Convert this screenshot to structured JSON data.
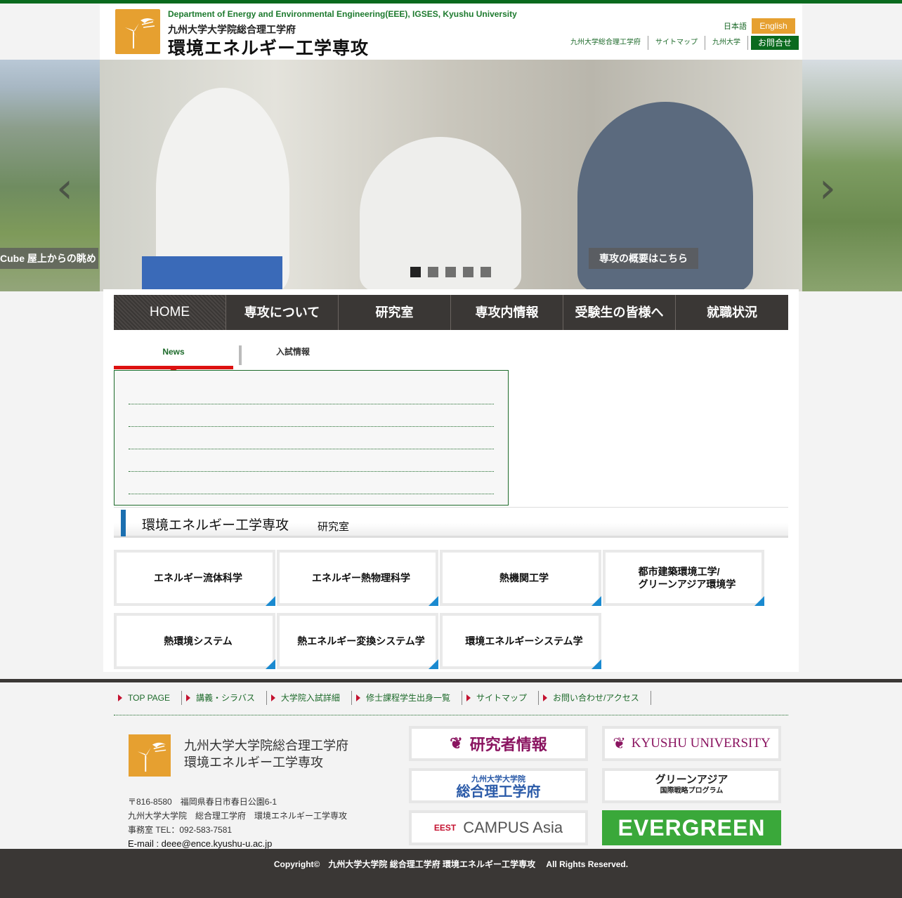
{
  "header": {
    "dept_en": "Department of Energy and Environmental Engineering(EEE), IGSES, Kyushu University",
    "dept_jp_line1": "九州大学大学院総合理工学府",
    "dept_jp_line2": "環境エネルギー工学専攻",
    "lang_jp": "日本語",
    "lang_en": "English",
    "util_links": [
      "九州大学総合理工学府",
      "サイトマップ",
      "九州大学"
    ],
    "contact": "お問合せ"
  },
  "slider": {
    "caption_left": "Cube 屋上からの眺め",
    "caption_main": "専攻の概要はこちら",
    "dots": 5,
    "active_dot": 0
  },
  "gnav": [
    "HOME",
    "専攻について",
    "研究室",
    "専攻内情報",
    "受験生の皆様へ",
    "就職状況"
  ],
  "news": {
    "tabs": [
      "News",
      "入試情報"
    ],
    "items": [
      "",
      "",
      "",
      "",
      ""
    ]
  },
  "labs": {
    "heading": "環境エネルギー工学専攻",
    "subheading": "研究室",
    "items": [
      "エネルギー流体科学",
      "エネルギー熱物理科学",
      "熱機関工学",
      "都市建築環境工学/\nグリーンアジア環境学",
      "熱環境システム",
      "熱エネルギー変換システム学",
      "環境エネルギーシステム学"
    ]
  },
  "footer": {
    "nav": [
      "TOP PAGE",
      "講義・シラバス",
      "大学院入試詳細",
      "修士課程学生出身一覧",
      "サイトマップ",
      "お問い合わせ/アクセス"
    ],
    "title_line1": "九州大学大学院総合理工学府",
    "title_line2": "環境エネルギー工学専攻",
    "address_lines": [
      "〒816-8580　福岡県春日市春日公園6-1",
      "九州大学大学院　総合理工学府　環境エネルギー工学専攻",
      "事務室 TEL：092-583-7581"
    ],
    "email": "E-mail : deee@ence.kyushu-u.ac.jp",
    "banners": {
      "researcher": "研究者情報",
      "kyushu": "KYUSHU UNIVERSITY",
      "igses_small": "九州大学大学院",
      "igses": "総合理工学府",
      "ga": "グリーンアジア",
      "ga_small": "国際戦略プログラム",
      "eest": "EEST",
      "campus": "CAMPUS Asia",
      "evergreen": "EVERGREEN"
    }
  },
  "copyright": "Copyright©　九州大学大学院 総合理工学府 環境エネルギー工学専攻　 All Rights Reserved.",
  "colors": {
    "brand_green": "#0a6a1e",
    "accent_orange": "#e6a030",
    "nav_dark": "#3a3735",
    "tab_red": "#dd1111",
    "lab_corner_blue": "#1a8ad0"
  }
}
